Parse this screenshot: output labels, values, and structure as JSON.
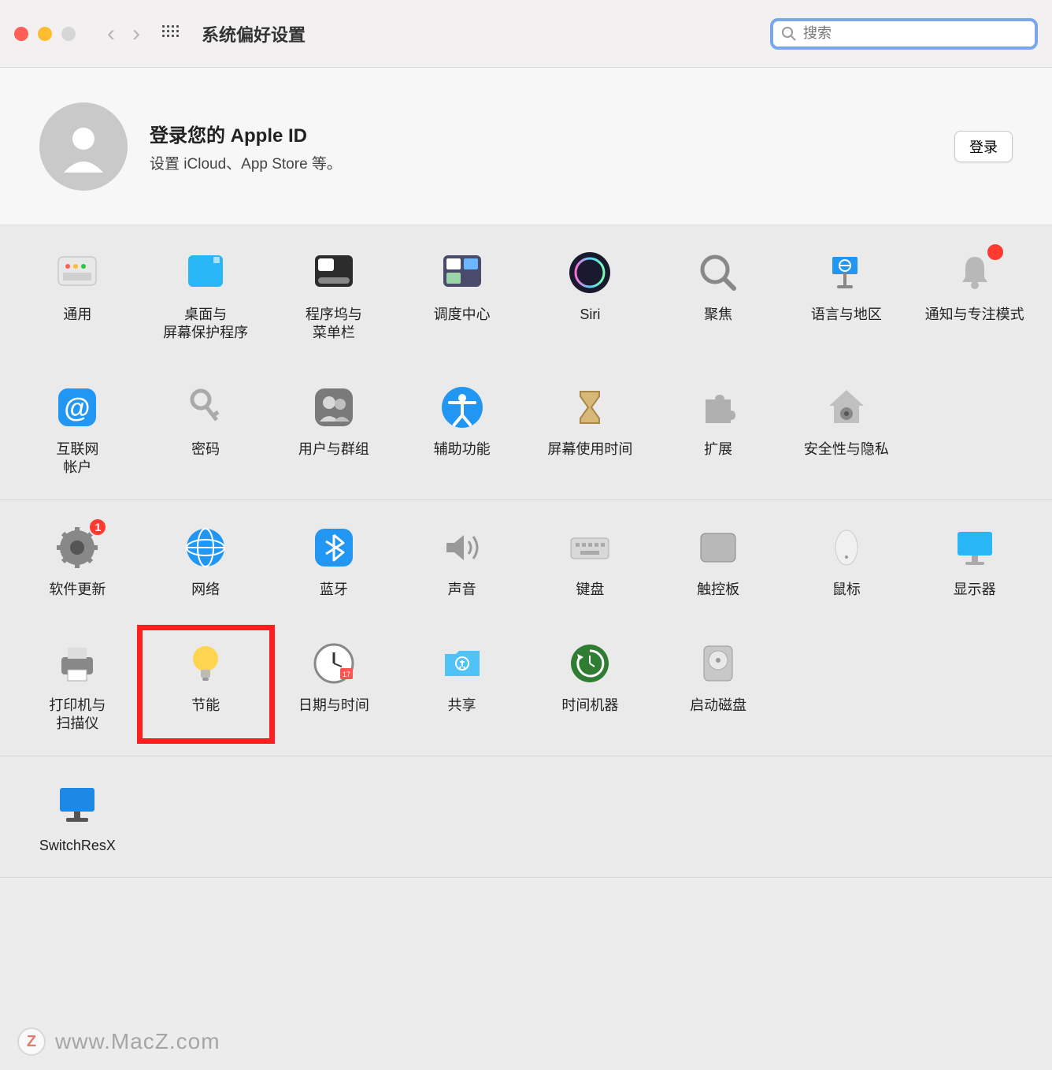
{
  "window": {
    "title": "系统偏好设置",
    "search_placeholder": "搜索"
  },
  "account": {
    "title": "登录您的 Apple ID",
    "subtitle": "设置 iCloud、App Store 等。",
    "signin_label": "登录"
  },
  "highlighted_item": "energy-saver",
  "sections": [
    {
      "items": [
        {
          "id": "general",
          "label": "通用",
          "icon": "general-icon"
        },
        {
          "id": "desktop",
          "label": "桌面与\n屏幕保护程序",
          "icon": "desktop-icon"
        },
        {
          "id": "dock",
          "label": "程序坞与\n菜单栏",
          "icon": "dock-icon"
        },
        {
          "id": "mission-control",
          "label": "调度中心",
          "icon": "mission-control-icon"
        },
        {
          "id": "siri",
          "label": "Siri",
          "icon": "siri-icon"
        },
        {
          "id": "spotlight",
          "label": "聚焦",
          "icon": "spotlight-icon"
        },
        {
          "id": "language-region",
          "label": "语言与地区",
          "icon": "language-icon"
        },
        {
          "id": "notifications",
          "label": "通知与专注模式",
          "icon": "notifications-icon",
          "badge": ""
        }
      ]
    },
    {
      "continues": true,
      "items": [
        {
          "id": "internet-accounts",
          "label": "互联网\n帐户",
          "icon": "at-icon"
        },
        {
          "id": "passwords",
          "label": "密码",
          "icon": "key-icon"
        },
        {
          "id": "users-groups",
          "label": "用户与群组",
          "icon": "users-icon"
        },
        {
          "id": "accessibility",
          "label": "辅助功能",
          "icon": "accessibility-icon"
        },
        {
          "id": "screen-time",
          "label": "屏幕使用时间",
          "icon": "hourglass-icon"
        },
        {
          "id": "extensions",
          "label": "扩展",
          "icon": "puzzle-icon"
        },
        {
          "id": "security-privacy",
          "label": "安全性与隐私",
          "icon": "house-icon"
        }
      ]
    },
    {
      "items": [
        {
          "id": "software-update",
          "label": "软件更新",
          "icon": "gear-icon",
          "badge": "1"
        },
        {
          "id": "network",
          "label": "网络",
          "icon": "network-icon"
        },
        {
          "id": "bluetooth",
          "label": "蓝牙",
          "icon": "bluetooth-icon"
        },
        {
          "id": "sound",
          "label": "声音",
          "icon": "speaker-icon"
        },
        {
          "id": "keyboard",
          "label": "键盘",
          "icon": "keyboard-icon"
        },
        {
          "id": "trackpad",
          "label": "触控板",
          "icon": "trackpad-icon"
        },
        {
          "id": "mouse",
          "label": "鼠标",
          "icon": "mouse-icon"
        },
        {
          "id": "displays",
          "label": "显示器",
          "icon": "display-icon"
        }
      ]
    },
    {
      "continues": true,
      "items": [
        {
          "id": "printers-scanners",
          "label": "打印机与\n扫描仪",
          "icon": "printer-icon"
        },
        {
          "id": "energy-saver",
          "label": "节能",
          "icon": "bulb-icon"
        },
        {
          "id": "date-time",
          "label": "日期与时间",
          "icon": "clock-icon"
        },
        {
          "id": "sharing",
          "label": "共享",
          "icon": "folder-icon"
        },
        {
          "id": "time-machine",
          "label": "时间机器",
          "icon": "timemachine-icon"
        },
        {
          "id": "startup-disk",
          "label": "启动磁盘",
          "icon": "disk-icon"
        }
      ]
    },
    {
      "items": [
        {
          "id": "switchresx",
          "label": "SwitchResX",
          "icon": "switchresx-icon"
        }
      ]
    }
  ],
  "watermark": {
    "badge": "Z",
    "text": "www.MacZ.com"
  }
}
